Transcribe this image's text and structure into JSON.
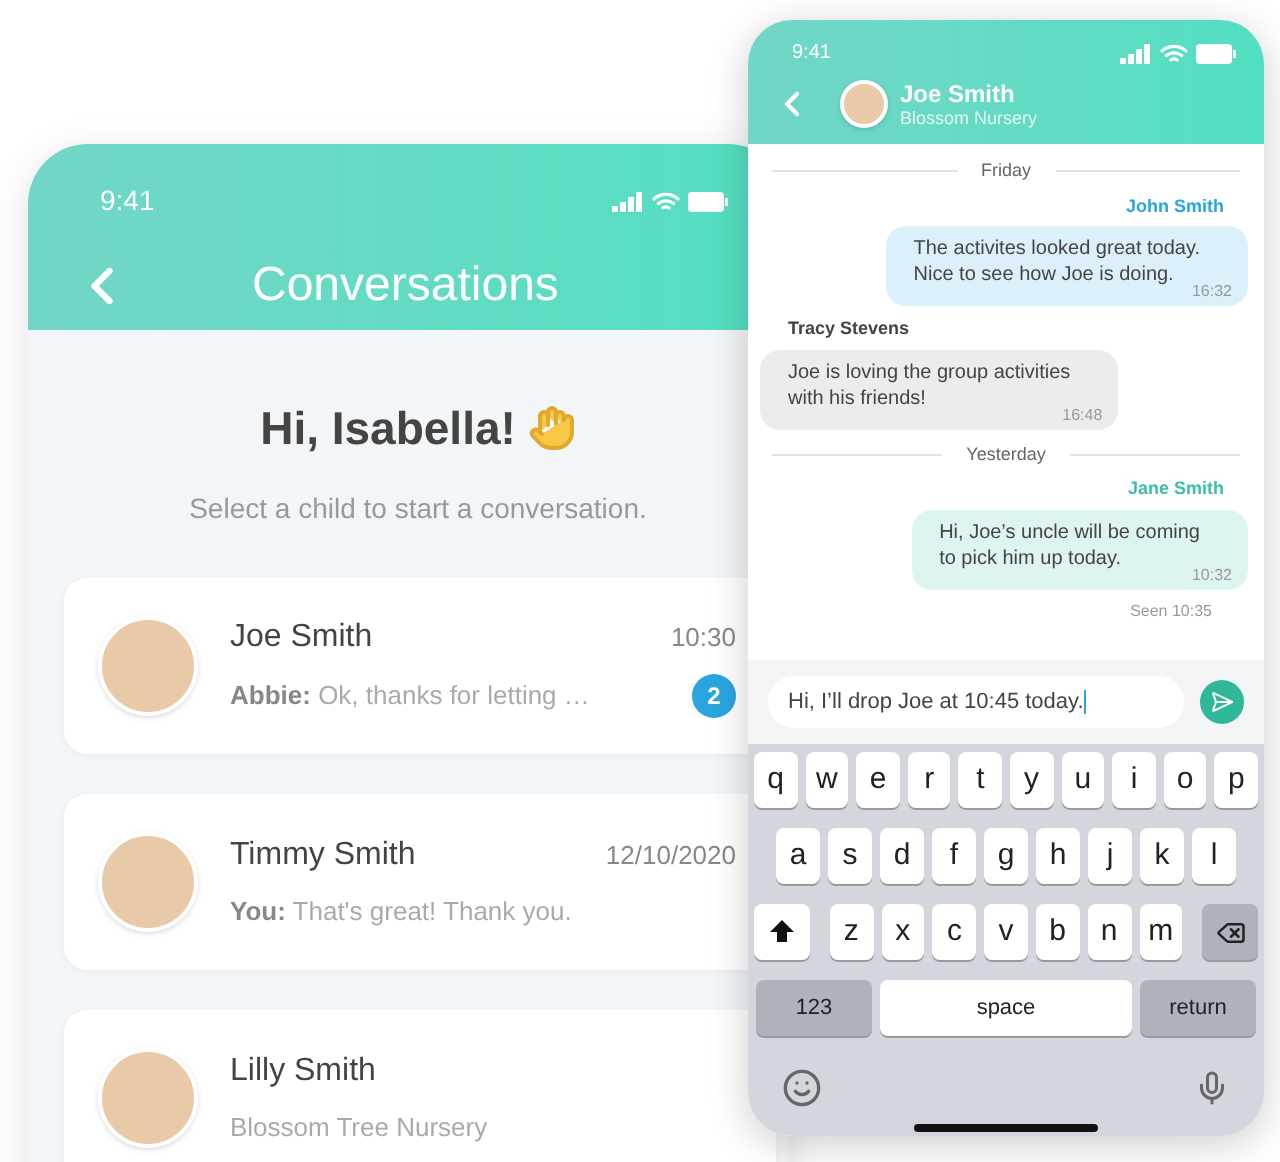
{
  "conversations_screen": {
    "status_time": "9:41",
    "title": "Conversations",
    "greeting": "Hi, Isabella!",
    "subtitle": "Select a child to start a conversation.",
    "children": [
      {
        "name": "Joe Smith",
        "preview": "**Abbie:** Ok, thanks for letting …",
        "time": "10:30",
        "unread": "2"
      },
      {
        "name": "Timmy Smith",
        "preview": "**You:** That's great! Thank you.",
        "time": "12/10/2020"
      },
      {
        "name": "Lilly Smith",
        "preview": "Blossom Tree Nursery"
      }
    ]
  },
  "chat_screen": {
    "status_time": "9:41",
    "contact_name": "Joe Smith",
    "contact_subtitle": "Blossom Nursery",
    "messages": [
      {
        "kind": "divider",
        "text": "Friday"
      },
      {
        "kind": "outgoing",
        "sender": "John Smith",
        "color": "#2aa5df",
        "text": "The activites looked great today.\nNice to see how Joe is doing.",
        "time": "16:32"
      },
      {
        "kind": "incoming",
        "sender": "Tracy Stevens",
        "color": "#444444",
        "text": "Joe is loving the group activities\nwith his friends!",
        "time": "16:48"
      },
      {
        "kind": "divider",
        "text": "Yesterday"
      },
      {
        "kind": "outgoing",
        "sender": "Jane Smith",
        "color": "#3cbfa6",
        "text": "Hi, Joe’s uncle will be coming\nto pick him up today.",
        "time": "10:32"
      }
    ],
    "seen": "Seen 10:35",
    "input_value": "Hi, I’ll drop Joe at 10:45 today.",
    "keyboard": [
      [
        {
          "kind": "letter",
          "label": "q"
        },
        {
          "kind": "letter",
          "label": "w"
        },
        {
          "kind": "letter",
          "label": "e"
        },
        {
          "kind": "letter",
          "label": "r"
        },
        {
          "kind": "letter",
          "label": "t"
        },
        {
          "kind": "letter",
          "label": "y"
        },
        {
          "kind": "letter",
          "label": "u"
        },
        {
          "kind": "letter",
          "label": "i"
        },
        {
          "kind": "letter",
          "label": "o"
        },
        {
          "kind": "letter",
          "label": "p"
        }
      ],
      [
        {
          "kind": "letter",
          "label": "a"
        },
        {
          "kind": "letter",
          "label": "s"
        },
        {
          "kind": "letter",
          "label": "d"
        },
        {
          "kind": "letter",
          "label": "f"
        },
        {
          "kind": "letter",
          "label": "g"
        },
        {
          "kind": "letter",
          "label": "h"
        },
        {
          "kind": "letter",
          "label": "j"
        },
        {
          "kind": "letter",
          "label": "k"
        },
        {
          "kind": "letter",
          "label": "l"
        }
      ],
      [
        {
          "kind": "shift"
        },
        {
          "kind": "letter",
          "label": "z"
        },
        {
          "kind": "letter",
          "label": "x"
        },
        {
          "kind": "letter",
          "label": "c"
        },
        {
          "kind": "letter",
          "label": "v"
        },
        {
          "kind": "letter",
          "label": "b"
        },
        {
          "kind": "letter",
          "label": "n"
        },
        {
          "kind": "letter",
          "label": "m"
        },
        {
          "kind": "backspace"
        }
      ],
      [
        {
          "kind": "function",
          "label": "123"
        },
        {
          "kind": "space",
          "label": "space"
        },
        {
          "kind": "function",
          "label": "return"
        }
      ]
    ]
  }
}
